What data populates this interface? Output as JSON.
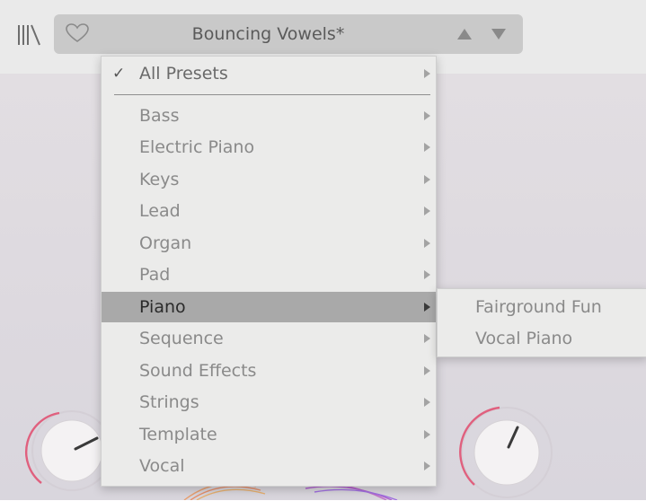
{
  "header": {
    "preset_name": "Bouncing Vowels*",
    "icons": {
      "library": "library-icon",
      "favorite": "heart-icon",
      "previous": "triangle-up-icon",
      "next": "triangle-down-icon"
    }
  },
  "menu": {
    "all_presets": {
      "check": "✓",
      "label": "All Presets"
    },
    "items": [
      {
        "label": "Bass"
      },
      {
        "label": "Electric Piano"
      },
      {
        "label": "Keys"
      },
      {
        "label": "Lead"
      },
      {
        "label": "Organ"
      },
      {
        "label": "Pad"
      },
      {
        "label": "Piano",
        "active": true
      },
      {
        "label": "Sequence"
      },
      {
        "label": "Sound Effects"
      },
      {
        "label": "Strings"
      },
      {
        "label": "Template"
      },
      {
        "label": "Vocal"
      }
    ]
  },
  "submenu": {
    "items": [
      {
        "label": "Fairground Fun"
      },
      {
        "label": "Vocal Piano"
      }
    ]
  },
  "colors": {
    "knob_ring_accent": "#e0607e",
    "menu_active_bg": "#a9a9a9",
    "menu_bg": "#ebebea"
  }
}
